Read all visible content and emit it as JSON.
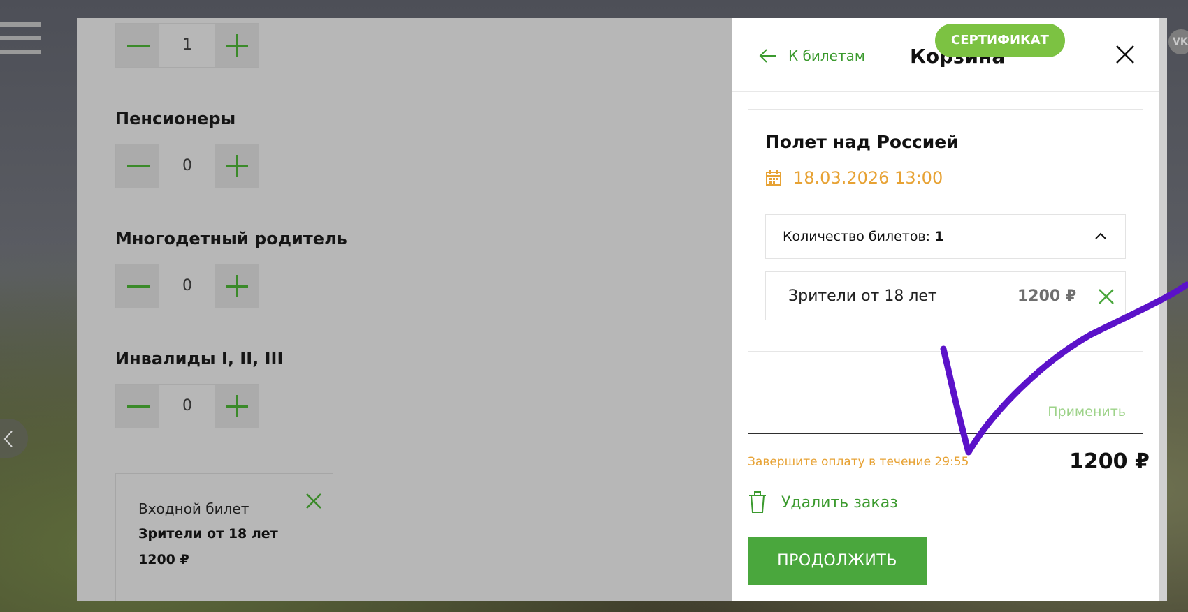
{
  "categories": [
    {
      "title": "",
      "count": "1"
    },
    {
      "title": "Пенсионеры",
      "count": "0"
    },
    {
      "title": "Многодетный родитель",
      "count": "0"
    },
    {
      "title": "Инвалиды I, II, III",
      "count": "0"
    }
  ],
  "ticket_summary": {
    "type": "Входной билет",
    "audience": "Зрители от 18 лет",
    "price": "1200 ₽"
  },
  "header": {
    "back_label": "К билетам",
    "title": "Корзина",
    "certificate_label": "СЕРТИФИКАТ"
  },
  "cart": {
    "event_title": "Полет над Россией",
    "event_datetime": "18.03.2026 13:00",
    "quantity_label": "Количество билетов:",
    "quantity_value": "1",
    "items": [
      {
        "name": "Зрители от 18 лет",
        "price": "1200 ₽"
      }
    ]
  },
  "promo": {
    "value": "",
    "apply_label": "Применить"
  },
  "timer_text": "Завершите оплату в течение 29:55",
  "total": "1200 ₽",
  "delete_order_label": "Удалить заказ",
  "continue_label": "ПРОДОЛЖИТЬ",
  "social": {
    "vk_label": "VK"
  },
  "colors": {
    "accent_green": "#4aa73d",
    "link_green": "#3b9a2e",
    "certificate_green": "#7cc242",
    "warning_orange": "#e7a234",
    "annotation_purple": "#5b12c9"
  }
}
